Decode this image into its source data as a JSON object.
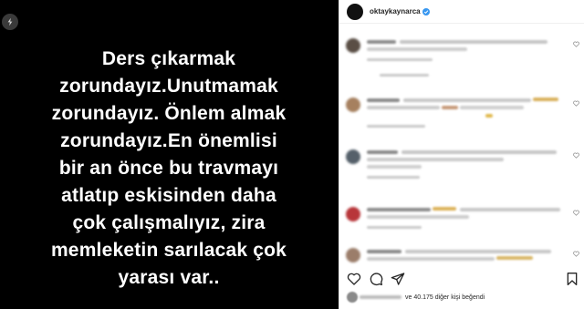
{
  "post": {
    "lines": [
      "Ders çıkarmak",
      "zorundayız.Unutmamak",
      "zorundayız. Önlem almak",
      "zorundayız.En önemlisi",
      "bir  an önce bu travmayı",
      "atlatıp eskisinden daha",
      "çok çalışmalıyız, zira",
      "memleketin sarılacak çok",
      "yarası var.."
    ]
  },
  "header": {
    "username": "oktaykaynarca"
  },
  "colors": {
    "image_background": "#000000",
    "image_text": "#ffffff",
    "verified_badge": "#3897f0"
  },
  "actions": {
    "icons": [
      "heart-icon",
      "comment-icon",
      "share-icon",
      "bookmark-icon"
    ]
  },
  "likes": {
    "text": "ve 40.175 diğer kişi beğendi"
  }
}
